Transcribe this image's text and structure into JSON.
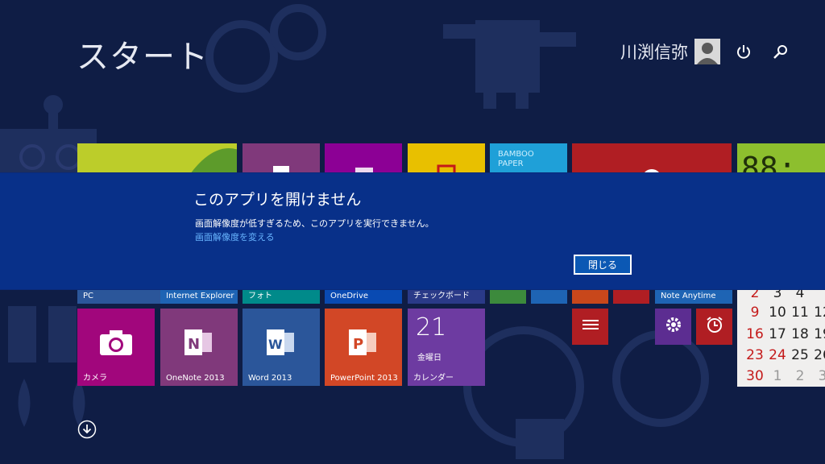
{
  "start": {
    "title": "スタート"
  },
  "user": {
    "name": "川渕信弥"
  },
  "top_tiles": {
    "bamboo_text_1": "BAMBOO",
    "bamboo_text_2": "PAPER"
  },
  "tile_row_labels": {
    "pc": "PC",
    "internet_explorer": "Internet Explorer",
    "photo": "フォト",
    "onedrive": "OneDrive",
    "checkboard": "チェックボード",
    "note_anytime": "Note Anytime"
  },
  "tiles": {
    "camera": "カメラ",
    "onenote": "OneNote 2013",
    "word": "Word 2013",
    "powerpoint": "PowerPoint 2013",
    "calendar": "カレンダー",
    "calendar_date": "21",
    "calendar_weekday": "金曜日"
  },
  "mini_calendar": {
    "row1": [
      "2",
      "3",
      "4"
    ],
    "row2": [
      "9",
      "10",
      "11",
      "12"
    ],
    "row3": [
      "16",
      "17",
      "18",
      "19"
    ],
    "row4": [
      "23",
      "24",
      "25",
      "26"
    ],
    "row5": [
      "30",
      "1",
      "2",
      "3"
    ]
  },
  "dialog": {
    "title": "このアプリを開けません",
    "message": "画面解像度が低すぎるため、このアプリを実行できません。",
    "link": "画面解像度を変える",
    "close_label": "閉じる"
  },
  "colors": {
    "background": "#0f1d45",
    "dialog": "#083089",
    "link": "#68b5ff",
    "onenote": "#80397b",
    "word": "#2b569a",
    "powerpoint": "#d24726",
    "camera": "#a1067c",
    "calendar": "#6d3ba1"
  }
}
